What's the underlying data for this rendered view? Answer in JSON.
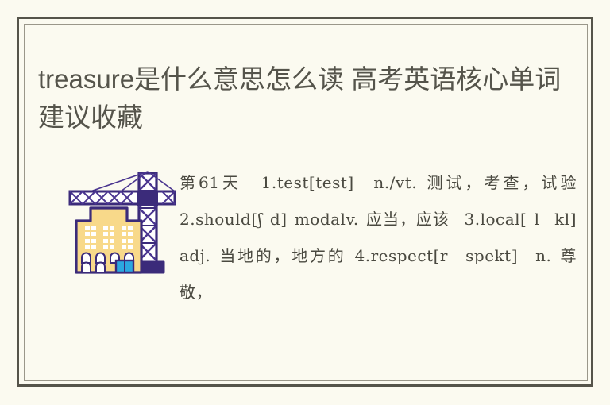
{
  "page": {
    "background_color": "#FBFAF0",
    "frame_outer_color": "#55544A",
    "frame_inner_color": "#9A978A"
  },
  "article": {
    "title": "treasure是什么意思怎么读 高考英语核心单词建议收藏",
    "title_color": "#55544B"
  },
  "illustration": {
    "name": "construction-crane-and-building",
    "colors": {
      "outline": "#3B2B7A",
      "crane": "#4A3590",
      "crane_light": "#EDE7F6",
      "building_wall": "#F8D98A",
      "building_wall_light": "#FCEBBC",
      "window": "#FFFFFF",
      "door": "#2BA8E0"
    }
  },
  "body": {
    "text_color": "#4A4940",
    "lines": [
      "第61天  1.test[test]  n./vt. 测",
      "试，考查，试验  2.should[   d]",
      "  modalv. 应当，应该  3.local[",
      "  l    kl]  adj. 当地的，地方的",
      "4.respect[r    spekt]  n. 尊敬，"
    ],
    "full_text": "第61天  1.test[test]  n./vt. 测试，考查，试验  2.should[ʃ d] modalv. 应当，应该  3.local[ l  kl]  adj. 当地的，地方的 4.respect[r  spekt]  n. 尊敬，",
    "entries": [
      {
        "index": "1.",
        "word": "test",
        "phonetic": "[test]",
        "pos": "n./vt.",
        "meaning": "测试，考查，试验"
      },
      {
        "index": "2.",
        "word": "should",
        "phonetic": "[   d]",
        "pos": "modalv.",
        "meaning": "应当，应该"
      },
      {
        "index": "3.",
        "word": "local",
        "phonetic": "[ l    kl]",
        "pos": "adj.",
        "meaning": "当地的，地方的"
      },
      {
        "index": "4.",
        "word": "respect",
        "phonetic": "[r    spekt]",
        "pos": "n.",
        "meaning": "尊敬，"
      }
    ],
    "day_label": "第61天"
  }
}
